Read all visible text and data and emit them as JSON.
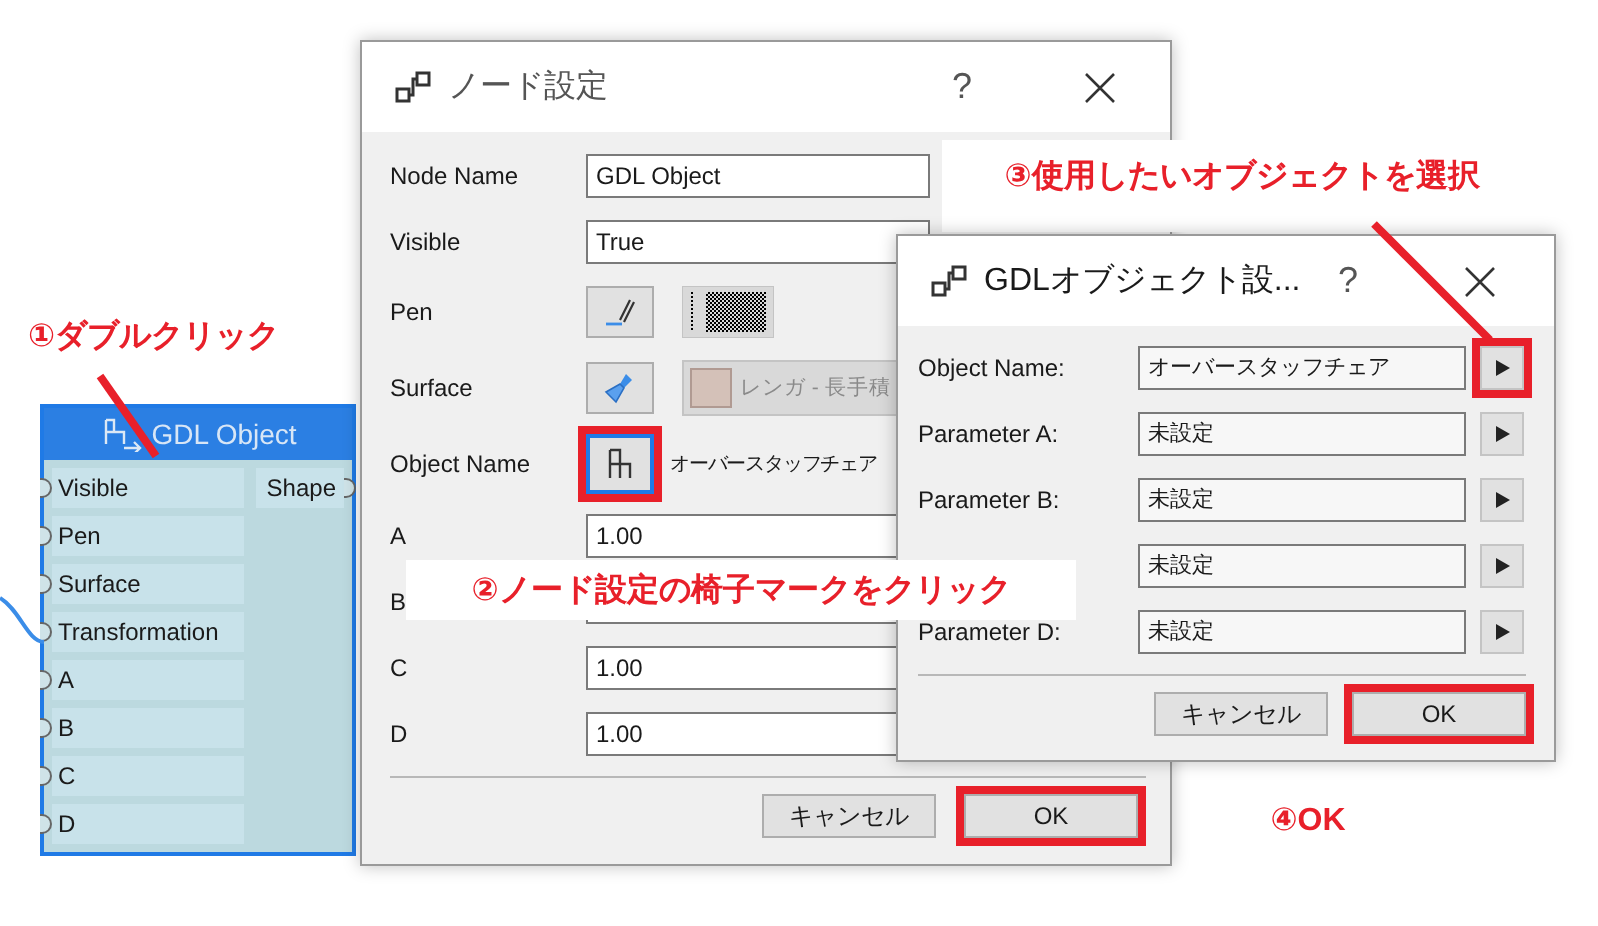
{
  "node": {
    "title": "GDL Object",
    "inputs": [
      {
        "label": "Visible",
        "connected": false
      },
      {
        "label": "Pen",
        "connected": false
      },
      {
        "label": "Surface",
        "connected": false
      },
      {
        "label": "Transformation",
        "connected": true
      },
      {
        "label": "A",
        "connected": false
      },
      {
        "label": "B",
        "connected": false
      },
      {
        "label": "C",
        "connected": false
      },
      {
        "label": "D",
        "connected": false
      }
    ],
    "outputs": [
      {
        "label": "Shape"
      }
    ]
  },
  "node_settings": {
    "title": "ノード設定",
    "help": "?",
    "rows": [
      {
        "kind": "text",
        "label": "Node Name",
        "value": "GDL Object"
      },
      {
        "kind": "text",
        "label": "Visible",
        "value": "True"
      },
      {
        "kind": "pen",
        "label": "Pen",
        "highlighted": false
      },
      {
        "kind": "surface",
        "label": "Surface",
        "value": "レンガ - 長手積",
        "disabled": true,
        "highlighted": false
      },
      {
        "kind": "object",
        "label": "Object Name",
        "value": "オーバースタッフチェア",
        "highlighted": true
      },
      {
        "kind": "text",
        "label": "A",
        "value": "1.00"
      },
      {
        "kind": "text",
        "label": "B"
      },
      {
        "kind": "text",
        "label": "C",
        "value": "1.00"
      },
      {
        "kind": "text",
        "label": "D",
        "value": "1.00"
      }
    ],
    "buttons": [
      {
        "label": "キャンセル",
        "highlighted": false
      },
      {
        "label": "OK",
        "highlighted": true
      }
    ]
  },
  "gdl_object_settings": {
    "title": "GDLオブジェクト設...",
    "help": "?",
    "rows": [
      {
        "label": "Object Name:",
        "value": "オーバースタッフチェア",
        "highlighted": true
      },
      {
        "label": "Parameter A:",
        "value": "未設定",
        "highlighted": false
      },
      {
        "label": "Parameter B:",
        "value": "未設定",
        "highlighted": false
      },
      {
        "value": "未設定",
        "highlighted": false
      },
      {
        "label": "Parameter D:",
        "value": "未設定",
        "highlighted": false
      }
    ],
    "buttons": [
      {
        "label": "キャンセル",
        "highlighted": false
      },
      {
        "label": "OK",
        "highlighted": true
      }
    ]
  },
  "annotations": [
    {
      "text": "①ダブルクリック",
      "leader": true
    },
    {
      "text": "②ノード設定の椅子マークをクリック",
      "leader": false
    },
    {
      "text": "③使用したいオブジェクトを選択",
      "leader": true
    },
    {
      "text": "④OK",
      "leader": false
    }
  ]
}
